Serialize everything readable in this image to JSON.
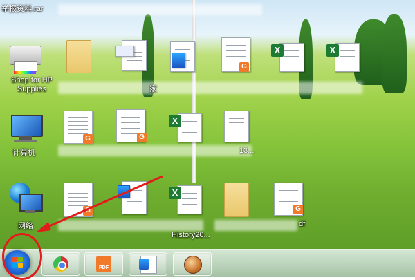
{
  "desktop": {
    "icons": [
      {
        "label": "举报资料.rar"
      },
      {
        "label": "Shop for HP Supplies"
      },
      {
        "label": "计算机"
      },
      {
        "label": "网络"
      },
      {
        "label": "家"
      },
      {
        "label": "13..."
      },
      {
        "label": "History20..."
      },
      {
        "label": "df"
      }
    ]
  },
  "taskbar": {
    "start_label": "Start",
    "pinned": [
      {
        "name": "chrome"
      },
      {
        "name": "pdf",
        "badge": "PDF"
      },
      {
        "name": "word"
      },
      {
        "name": "browser-tiger"
      }
    ]
  },
  "annotation": {
    "color": "#e21b1b"
  }
}
